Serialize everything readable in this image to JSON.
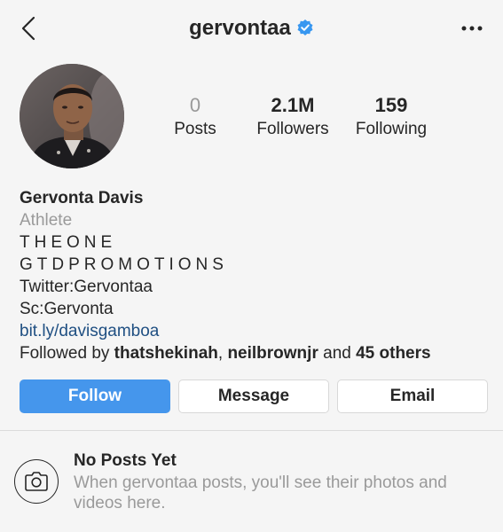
{
  "header": {
    "username": "gervontaa"
  },
  "profile": {
    "stats": [
      {
        "value": "0",
        "label": "Posts"
      },
      {
        "value": "2.1M",
        "label": "Followers"
      },
      {
        "value": "159",
        "label": "Following"
      }
    ],
    "name": "Gervonta Davis",
    "category": "Athlete",
    "bio_line1": "THEONE",
    "bio_line2": "GTDPROMOTIONS",
    "bio_line3": "Twitter:Gervontaa",
    "bio_line4": "Sc:Gervonta",
    "link": "bit.ly/davisgamboa",
    "followed_by": {
      "prefix": "Followed by ",
      "user1": "thatshekinah",
      "sep": ", ",
      "user2": "neilbrownjr",
      "and": " and ",
      "others": "45 others"
    }
  },
  "actions": {
    "follow": "Follow",
    "message": "Message",
    "email": "Email"
  },
  "empty_state": {
    "title": "No Posts Yet",
    "text": "When gervontaa posts, you'll see their photos and videos here."
  },
  "colors": {
    "accent": "#4596ec",
    "link": "#1f4f82",
    "verified": "#3897f0",
    "muted": "#9a9a9a"
  },
  "icons": {
    "back": "chevron-left-icon",
    "verified": "verified-badge-icon",
    "more": "more-dots-icon",
    "camera": "camera-icon"
  }
}
